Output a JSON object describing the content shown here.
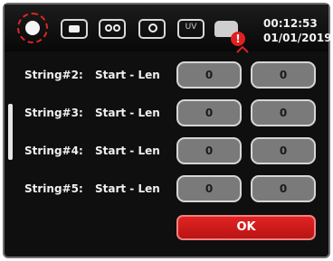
{
  "status": {
    "time": "00:12:53",
    "date": "01/01/2019",
    "alert_badge": "!"
  },
  "toolbar": {
    "icons": [
      "settings-icon",
      "battery-icon",
      "dual-lens-icon",
      "camera-icon",
      "uv-icon",
      "indicator-icon"
    ],
    "uv_label": "UV"
  },
  "rows": [
    {
      "name": "String#2:",
      "type": "Start - Len",
      "start": "0",
      "len": "0"
    },
    {
      "name": "String#3:",
      "type": "Start - Len",
      "start": "0",
      "len": "0"
    },
    {
      "name": "String#4:",
      "type": "Start - Len",
      "start": "0",
      "len": "0"
    },
    {
      "name": "String#5:",
      "type": "Start - Len",
      "start": "0",
      "len": "0"
    }
  ],
  "ok_label": "OK",
  "colors": {
    "accent": "#e22323",
    "background": "#0f0f0f",
    "field": "#7a7a7a"
  }
}
